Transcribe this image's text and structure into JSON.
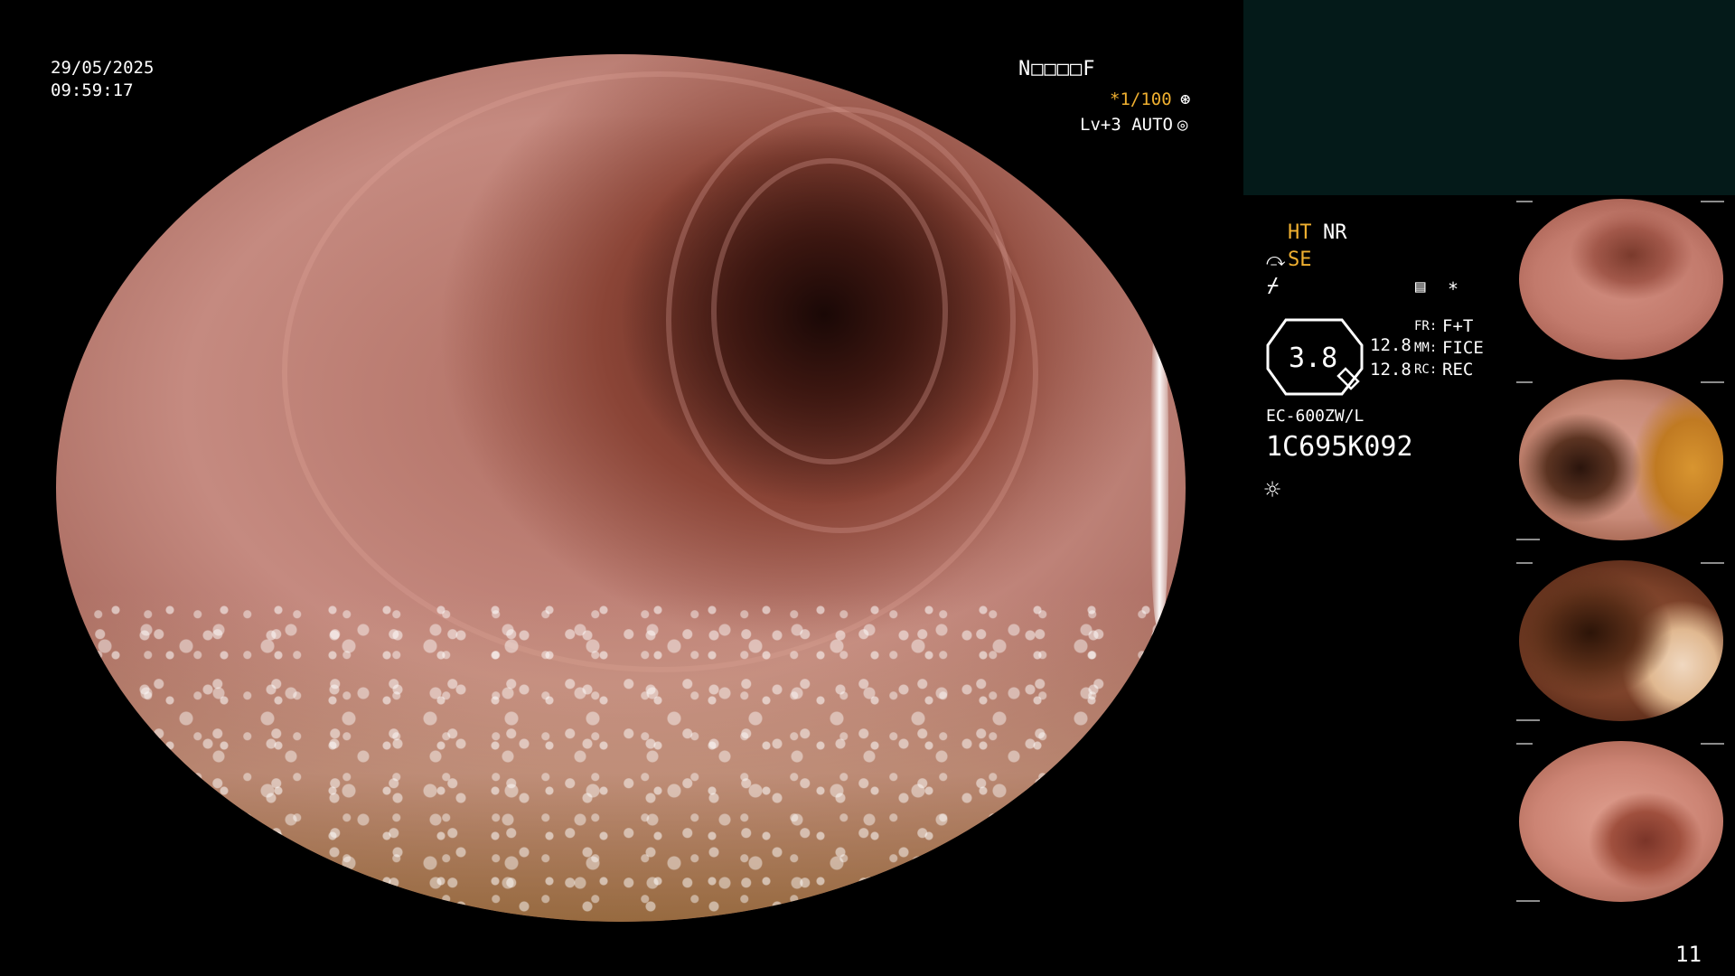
{
  "overlay": {
    "date": "29/05/2025",
    "time": "09:59:17",
    "patient_id": "N□□□□F",
    "shutter": "*1/100",
    "shutter_icon": "⊛",
    "level": "Lv+3 AUTO",
    "level_icon": "◎"
  },
  "panel": {
    "ht": "HT",
    "nr": "NR",
    "se_icon": "⤼",
    "se": "SE",
    "f_icon": "⌿",
    "memo_icon": "▤",
    "asterisk": "*",
    "zoom_value": "3.8",
    "val_a": "12.8",
    "val_b": "12.8",
    "fr_label": "FR:",
    "fr_val": "F+T",
    "mm_label": "MM:",
    "mm_val": "FICE",
    "rc_label": "RC:",
    "rc_val": "REC",
    "scope_model": "EC-600ZW/L",
    "scope_serial": "1C695K092",
    "light_icon": "☼"
  },
  "page_number": "11",
  "colors": {
    "accent_orange": "#f0b030",
    "info_box": "#041a19",
    "background": "#000000"
  }
}
